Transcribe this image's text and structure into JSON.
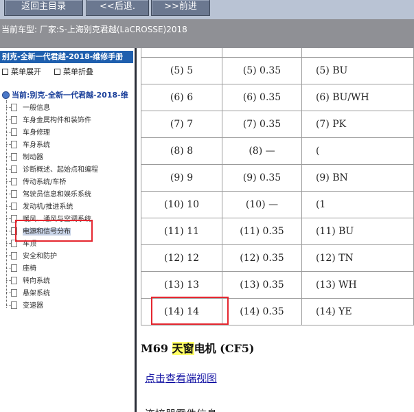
{
  "toolbar": {
    "home_label": "返回主目录",
    "back_label": "<<后退.",
    "forward_label": ">>前进"
  },
  "infobar": {
    "text": "当前车型:   厂家:S-上海别克君越(LaCROSSE)2018"
  },
  "left_panel": {
    "manual_title": "别克-全新一代君越-2018-维修手册",
    "expand_label": "菜单展开",
    "collapse_label": "菜单折叠",
    "current_label": "当前:别克-全新一代君越-2018-维",
    "tree_items": [
      "一般信息",
      "车身金属构件和装饰件",
      "车身修理",
      "车身系统",
      "制动器",
      "诊断概述、起始点和编程",
      "传动系统/车桥",
      "驾驶员信息和娱乐系统",
      "发动机/推进系统",
      "暖风、通风与空调系统",
      "电源和信号分布",
      "车顶",
      "安全和防护",
      "座椅",
      "转向系统",
      "悬架系统",
      "变速器"
    ],
    "selected_index": 10
  },
  "pin_table": {
    "rows": [
      [
        "",
        "",
        "("
      ],
      [
        "(5) 5",
        "(5) 0.35",
        "(5) BU"
      ],
      [
        "(6) 6",
        "(6) 0.35",
        "(6) BU/WH"
      ],
      [
        "(7) 7",
        "(7) 0.35",
        "(7) PK"
      ],
      [
        "(8) 8",
        "(8) —",
        "("
      ],
      [
        "(9) 9",
        "(9) 0.35",
        "(9) BN"
      ],
      [
        "(10) 10",
        "(10) —",
        "(1"
      ],
      [
        "(11) 11",
        "(11) 0.35",
        "(11) BU"
      ],
      [
        "(12) 12",
        "(12) 0.35",
        "(12) TN"
      ],
      [
        "(13) 13",
        "(13) 0.35",
        "(13) WH"
      ],
      [
        "(14) 14",
        "(14) 0.35",
        "(14) YE"
      ]
    ]
  },
  "section": {
    "heading_prefix": "M69 ",
    "heading_highlight": "天窗",
    "heading_suffix": "电机 (CF5)",
    "view_link": "点击查看端视图",
    "connector_info": "连接器零件信息"
  },
  "colors": {
    "toolbar_bg": "#b9c3d4",
    "button_bg": "#6b7890",
    "infobar_bg": "#8f9095",
    "title_bar_bg": "#1f5fae",
    "highlight_red": "#e5262f",
    "search_highlight": "#ffff66",
    "link": "#1a1aa6"
  }
}
